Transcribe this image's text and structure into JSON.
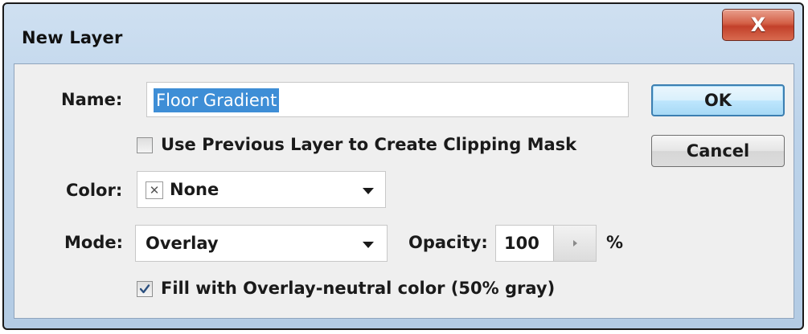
{
  "window": {
    "title": "New Layer",
    "close_glyph": "X"
  },
  "form": {
    "name_label": "Name:",
    "name_value": "Floor Gradient",
    "clipping_checkbox_label": "Use Previous Layer to Create Clipping Mask",
    "clipping_checked": false,
    "color_label": "Color:",
    "color_value": "None",
    "color_none_glyph": "✕",
    "mode_label": "Mode:",
    "mode_value": "Overlay",
    "opacity_label": "Opacity:",
    "opacity_value": "100",
    "opacity_unit": "%",
    "fill_checkbox_label": "Fill with Overlay-neutral color (50% gray)",
    "fill_checked": true
  },
  "buttons": {
    "ok_label": "OK",
    "cancel_label": "Cancel"
  },
  "icons": {
    "close": "close-icon",
    "dropdown": "chevron-down-icon",
    "spinner": "chevron-right-icon",
    "checkmark": "check-icon"
  },
  "colors": {
    "selection_highlight": "#3e8ed6",
    "close_button": "#c2402a",
    "ok_button_border": "#3c7fb1",
    "dialog_background": "#efefef"
  }
}
